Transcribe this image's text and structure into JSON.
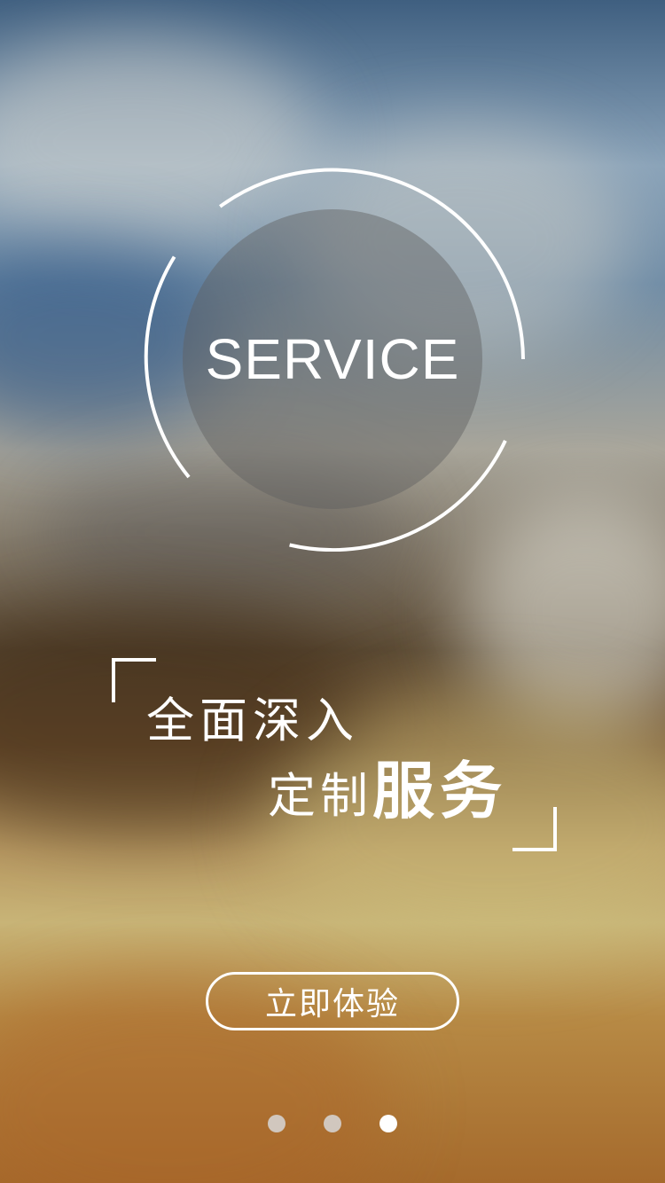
{
  "logo": {
    "text": "SERVICE"
  },
  "tagline": {
    "line1": "全面深入",
    "line2_light": "定制",
    "line2_bold": "服务"
  },
  "cta": {
    "label": "立即体验"
  },
  "pager": {
    "total": 3,
    "current": 3
  },
  "colors": {
    "text": "#ffffff",
    "dot_inactive": "#d7d7d7",
    "dot_active": "#ffffff"
  }
}
